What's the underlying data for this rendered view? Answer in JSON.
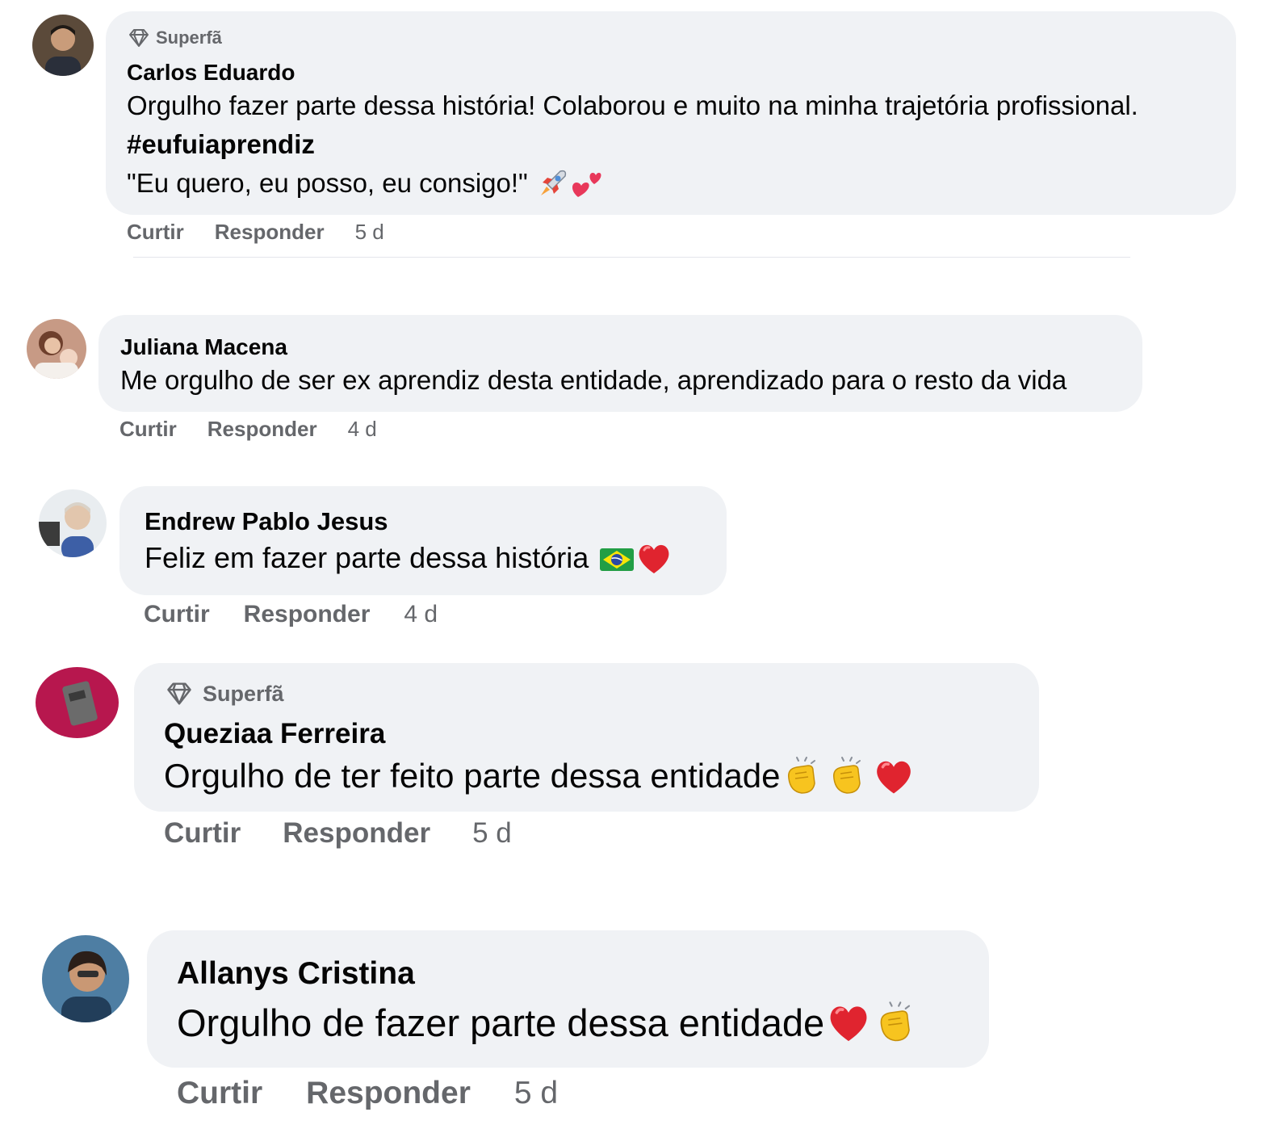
{
  "comments": [
    {
      "badge": "Superfã",
      "name": "Carlos Eduardo",
      "lines": [
        "Orgulho fazer parte dessa história! Colaborou e muito na minha trajetória profissional.",
        "#eufuiaprendiz",
        "\"Eu quero, eu posso, eu consigo!\""
      ],
      "emojis": [
        "rocket-icon",
        "two-hearts-icon"
      ],
      "like": "Curtir",
      "reply": "Responder",
      "time": "5 d"
    },
    {
      "name": "Juliana Macena",
      "lines": [
        "Me orgulho de ser ex aprendiz desta entidade, aprendizado para o resto da vida"
      ],
      "like": "Curtir",
      "reply": "Responder",
      "time": "4 d"
    },
    {
      "name": "Endrew Pablo Jesus",
      "lines": [
        "Feliz em fazer parte dessa história"
      ],
      "emojis": [
        "brazil-flag-icon",
        "red-heart-icon"
      ],
      "like": "Curtir",
      "reply": "Responder",
      "time": "4 d"
    },
    {
      "badge": "Superfã",
      "name": "Queziaa Ferreira",
      "lines": [
        "Orgulho de ter feito parte dessa entidade"
      ],
      "emojis": [
        "clapping-hands-icon",
        "clapping-hands-icon",
        "red-heart-icon"
      ],
      "like": "Curtir",
      "reply": "Responder",
      "time": "5 d"
    },
    {
      "name": "Allanys Cristina",
      "lines": [
        "Orgulho de fazer parte dessa entidade"
      ],
      "emojis": [
        "red-heart-icon",
        "clapping-hands-icon"
      ],
      "like": "Curtir",
      "reply": "Responder",
      "time": "5 d"
    }
  ],
  "colors": {
    "bubble": "#f0f2f5",
    "meta": "#65676b",
    "text": "#050505"
  }
}
